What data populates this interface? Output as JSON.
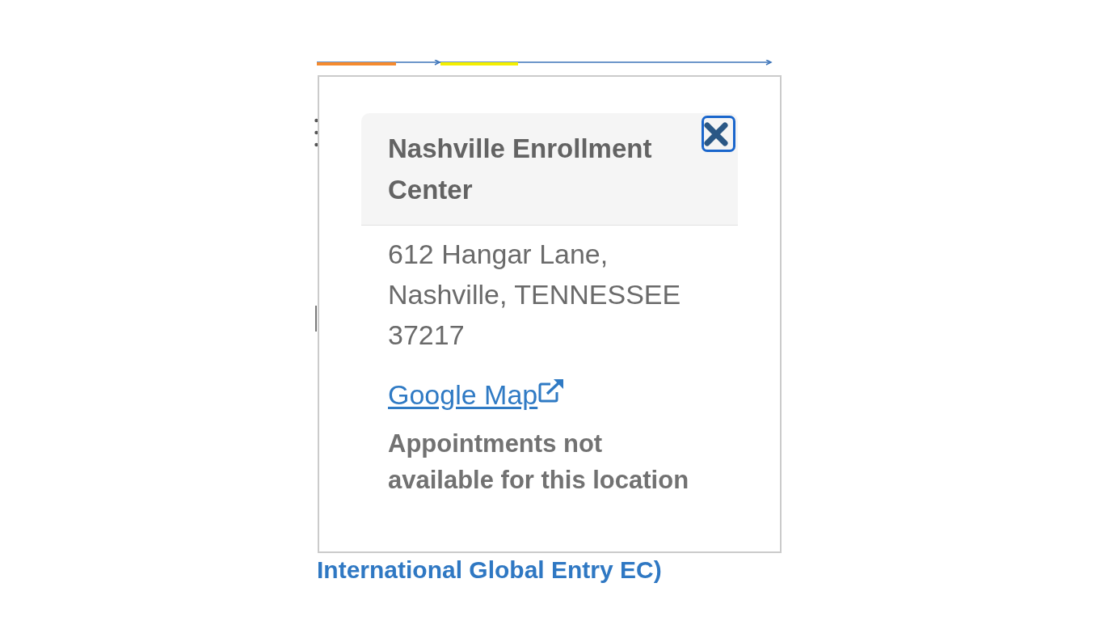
{
  "background": {
    "link_text": "International Global Entry EC)"
  },
  "popup": {
    "title": "Nashville Enrollment Center",
    "close_button": {
      "focused": true
    },
    "address": "612 Hangar Lane, Nashville, TENNESSEE 37217",
    "map_link": {
      "label": "Google Map",
      "external": true
    },
    "notice": "Appointments not available for this location"
  }
}
